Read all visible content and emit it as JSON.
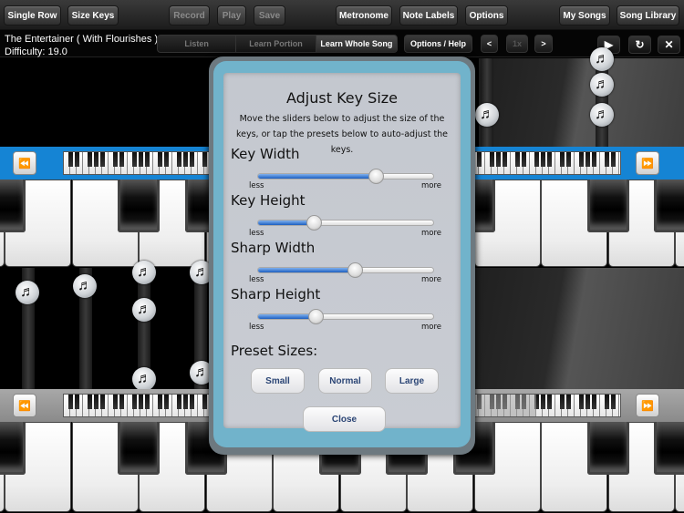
{
  "toolbar": {
    "single_row": "Single Row",
    "size_keys": "Size Keys",
    "record": "Record",
    "play": "Play",
    "save": "Save",
    "metronome": "Metronome",
    "note_labels": "Note Labels",
    "options": "Options",
    "my_songs": "My Songs",
    "song_library": "Song Library"
  },
  "song": {
    "title": "The Entertainer ( With Flourishes )",
    "difficulty": "Difficulty: 19.0"
  },
  "modes": [
    {
      "label": "Listen",
      "active": false
    },
    {
      "label": "Learn Portion",
      "active": false
    },
    {
      "label": "Learn Whole Song",
      "active": true
    }
  ],
  "controls": {
    "options_help": "Options / Help",
    "prev": "<",
    "speed": "1x",
    "next": ">",
    "play_icon": "▶",
    "restart_icon": "↻",
    "close_icon": "✕"
  },
  "navigation": {
    "rewind_icon": "⏪",
    "forward_icon": "⏩"
  },
  "note_icon": "♬",
  "modal": {
    "title": "Adjust Key Size",
    "description": "Move the sliders below to adjust the size of the keys, or tap the presets below to auto-adjust the keys.",
    "sliders": [
      {
        "label": "Key Width",
        "value": 0.67,
        "min_label": "less",
        "max_label": "more"
      },
      {
        "label": "Key Height",
        "value": 0.32,
        "min_label": "less",
        "max_label": "more"
      },
      {
        "label": "Sharp Width",
        "value": 0.55,
        "min_label": "less",
        "max_label": "more"
      },
      {
        "label": "Sharp Height",
        "value": 0.33,
        "min_label": "less",
        "max_label": "more"
      }
    ],
    "preset_heading": "Preset Sizes:",
    "presets": [
      "Small",
      "Normal",
      "Large"
    ],
    "close": "Close"
  },
  "colors": {
    "blue_strip": "#1584d4",
    "modal_frame": "#71b3cb",
    "button_text": "#2b4575",
    "slider_fill": "#1d5fc0"
  }
}
